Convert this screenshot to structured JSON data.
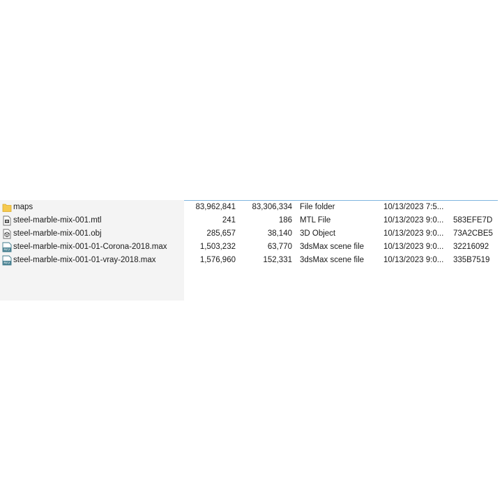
{
  "colors": {
    "panel_bg": "#f4f4f4",
    "header_line": "#7fb5df",
    "folder_yellow": "#f5c94e",
    "max_icon_teal": "#3f7b8c"
  },
  "files": [
    {
      "icon": "folder-icon",
      "name": "maps",
      "size": "83,962,841",
      "packed": "83,306,334",
      "type": "File folder",
      "modified": "10/13/2023 7:5...",
      "crc": ""
    },
    {
      "icon": "mtl-file-icon",
      "name": "steel-marble-mix-001.mtl",
      "size": "241",
      "packed": "186",
      "type": "MTL File",
      "modified": "10/13/2023 9:0...",
      "crc": "583EFE7D"
    },
    {
      "icon": "3d-object-icon",
      "name": "steel-marble-mix-001.obj",
      "size": "285,657",
      "packed": "38,140",
      "type": "3D Object",
      "modified": "10/13/2023 9:0...",
      "crc": "73A2CBE5"
    },
    {
      "icon": "max-file-icon",
      "name": "steel-marble-mix-001-01-Corona-2018.max",
      "size": "1,503,232",
      "packed": "63,770",
      "type": "3dsMax scene file",
      "modified": "10/13/2023 9:0...",
      "crc": "32216092"
    },
    {
      "icon": "max-file-icon",
      "name": "steel-marble-mix-001-01-vray-2018.max",
      "size": "1,576,960",
      "packed": "152,331",
      "type": "3dsMax scene file",
      "modified": "10/13/2023 9:0...",
      "crc": "335B7519"
    }
  ]
}
